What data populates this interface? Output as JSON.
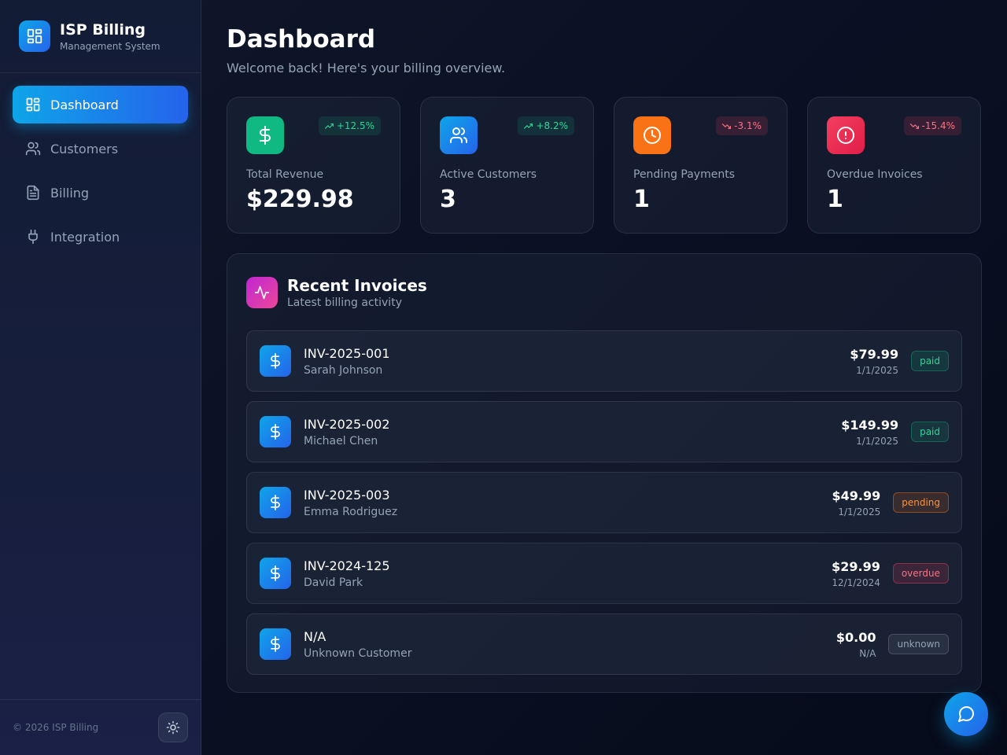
{
  "brand": {
    "title": "ISP Billing",
    "subtitle": "Management System",
    "icon": "layout-grid-icon"
  },
  "nav": {
    "items": [
      {
        "label": "Dashboard",
        "icon": "layout-grid-icon",
        "active": true
      },
      {
        "label": "Customers",
        "icon": "users-icon"
      },
      {
        "label": "Billing",
        "icon": "file-text-icon"
      },
      {
        "label": "Integration",
        "icon": "plug-icon"
      }
    ]
  },
  "footer": {
    "copyright": "© 2026 ISP Billing",
    "theme_icon": "sun-icon"
  },
  "header": {
    "title": "Dashboard",
    "subtitle": "Welcome back! Here's your billing overview."
  },
  "stats": [
    {
      "label": "Total Revenue",
      "value": "$229.98",
      "change": "+12.5%",
      "trend": "up",
      "icon": "dollar-icon",
      "color": "#10b981"
    },
    {
      "label": "Active Customers",
      "value": "3",
      "change": "+8.2%",
      "trend": "up",
      "icon": "users-icon",
      "color": "#0ea5e9"
    },
    {
      "label": "Pending Payments",
      "value": "1",
      "change": "-3.1%",
      "trend": "down",
      "icon": "clock-icon",
      "color": "#f97316"
    },
    {
      "label": "Overdue Invoices",
      "value": "1",
      "change": "-15.4%",
      "trend": "down",
      "icon": "alert-circle-icon",
      "color": "#f43f5e"
    }
  ],
  "invoices": {
    "title": "Recent Invoices",
    "subtitle": "Latest billing activity",
    "icon": "activity-icon",
    "items": [
      {
        "number": "INV-2025-001",
        "customer": "Sarah Johnson",
        "amount": "$79.99",
        "date": "1/1/2025",
        "status": "paid"
      },
      {
        "number": "INV-2025-002",
        "customer": "Michael Chen",
        "amount": "$149.99",
        "date": "1/1/2025",
        "status": "paid"
      },
      {
        "number": "INV-2025-003",
        "customer": "Emma Rodriguez",
        "amount": "$49.99",
        "date": "1/1/2025",
        "status": "pending"
      },
      {
        "number": "INV-2024-125",
        "customer": "David Park",
        "amount": "$29.99",
        "date": "12/1/2024",
        "status": "overdue"
      },
      {
        "number": "N/A",
        "customer": "Unknown Customer",
        "amount": "$0.00",
        "date": "N/A",
        "status": "unknown"
      }
    ]
  },
  "chat": {
    "icon": "message-circle-icon"
  }
}
